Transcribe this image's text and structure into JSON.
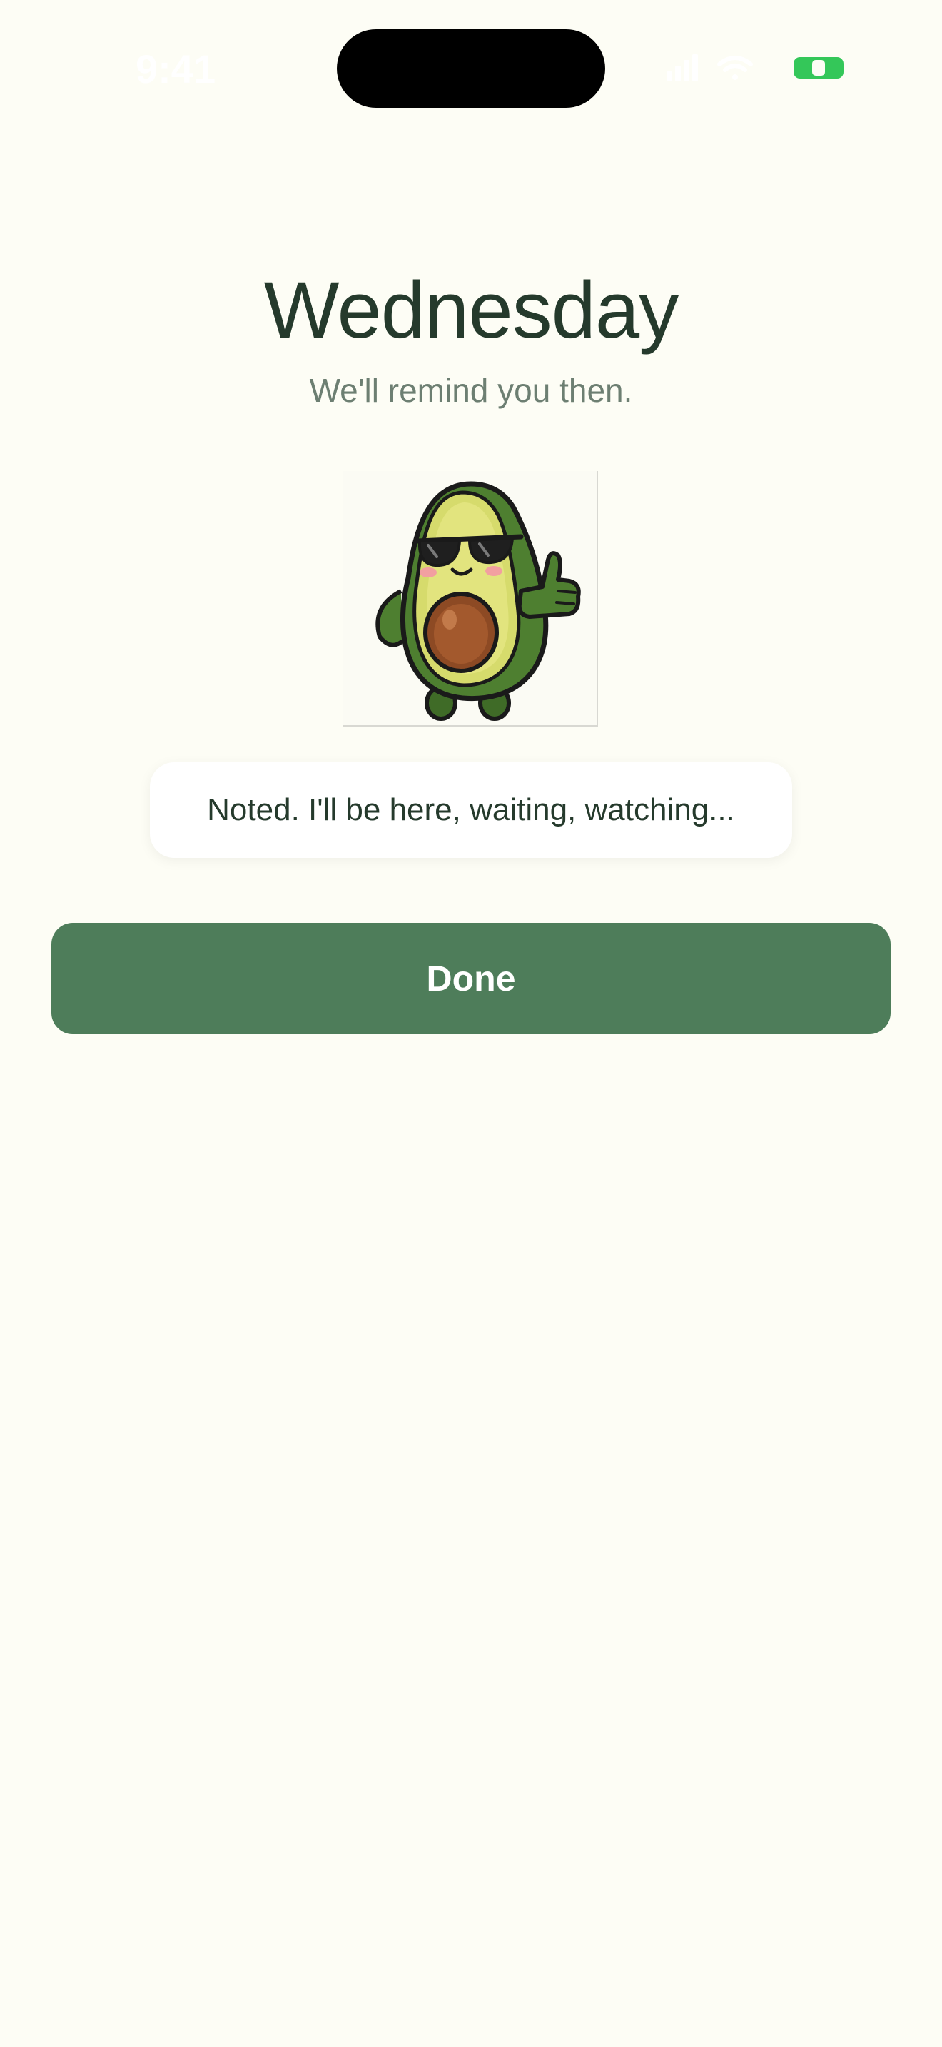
{
  "status_bar": {
    "time": "9:41",
    "icons": [
      "signal-icon",
      "wifi-icon",
      "battery-icon"
    ],
    "battery_color": "#34c759"
  },
  "header": {
    "title": "Wednesday",
    "subtitle": "We'll remind you then."
  },
  "mascot": {
    "icon": "avocado-thumbs-up-icon"
  },
  "message": {
    "text": "Noted. I'll be here, waiting, watching..."
  },
  "actions": {
    "done_label": "Done"
  },
  "colors": {
    "background": "#fdfdf5",
    "primary": "#4e7d5a",
    "title": "#253a2c",
    "subtitle": "#6d7f72"
  }
}
